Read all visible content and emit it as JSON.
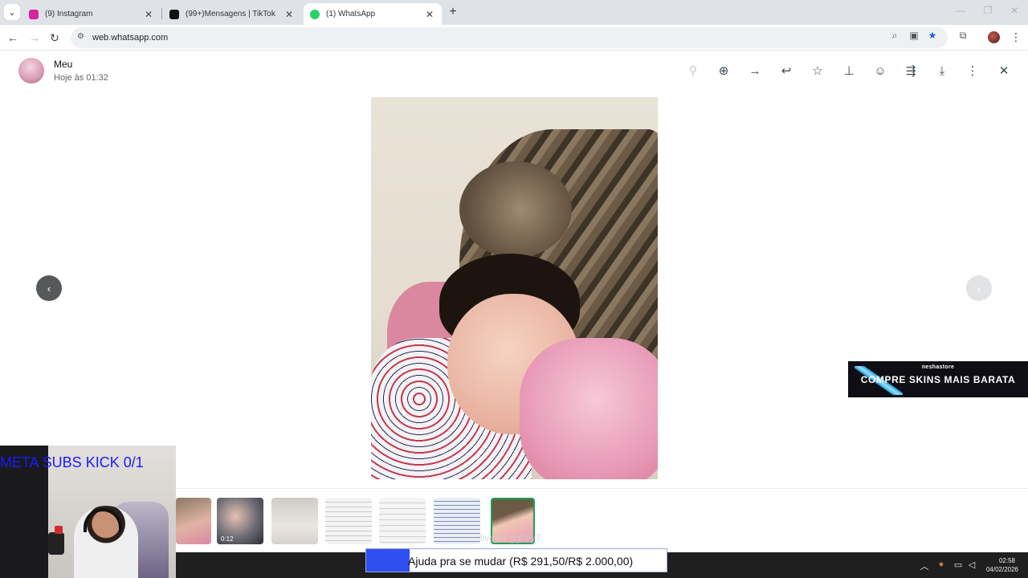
{
  "browser": {
    "tabs": [
      {
        "title": "(9) Instagram",
        "favicon": "instagram-icon",
        "color": "#d6249f"
      },
      {
        "title": "(99+)Mensagens | TikTok",
        "favicon": "tiktok-icon",
        "color": "#111111"
      },
      {
        "title": "(1) WhatsApp",
        "favicon": "whatsapp-icon",
        "color": "#25d366",
        "active": true
      }
    ],
    "url": "web.whatsapp.com",
    "new_tab_symbol": "+"
  },
  "viewer": {
    "contact_name": "Meu",
    "timestamp": "Hoje às 01:32",
    "toolbar_icons": [
      "zoom-out-icon",
      "zoom-in-icon",
      "forward-arrow-icon",
      "reply-icon",
      "star-icon",
      "pin-icon",
      "emoji-icon",
      "share-icon",
      "download-icon",
      "more-icon",
      "close-icon"
    ],
    "video_duration": "0:12",
    "thumbnail_count": 7,
    "selected_thumbnail": 7
  },
  "ad": {
    "brand": "neshastore",
    "text": "COMPRE SKINS MAIS BARATA"
  },
  "stream": {
    "goal_text": "META SUBS KICK 0/1",
    "livepix_text": "livepix.gg/dly7",
    "donation_label": "Ajuda pra se mudar (R$ 291,50/R$ 2.000,00)",
    "donation_progress": 0.1457
  },
  "taskbar": {
    "time": "02:58",
    "date": "04/02/2026"
  },
  "colors": {
    "whatsapp_green": "#1aa156",
    "donation_fill": "#2f4ff0",
    "goal_text": "#1a1aff"
  }
}
